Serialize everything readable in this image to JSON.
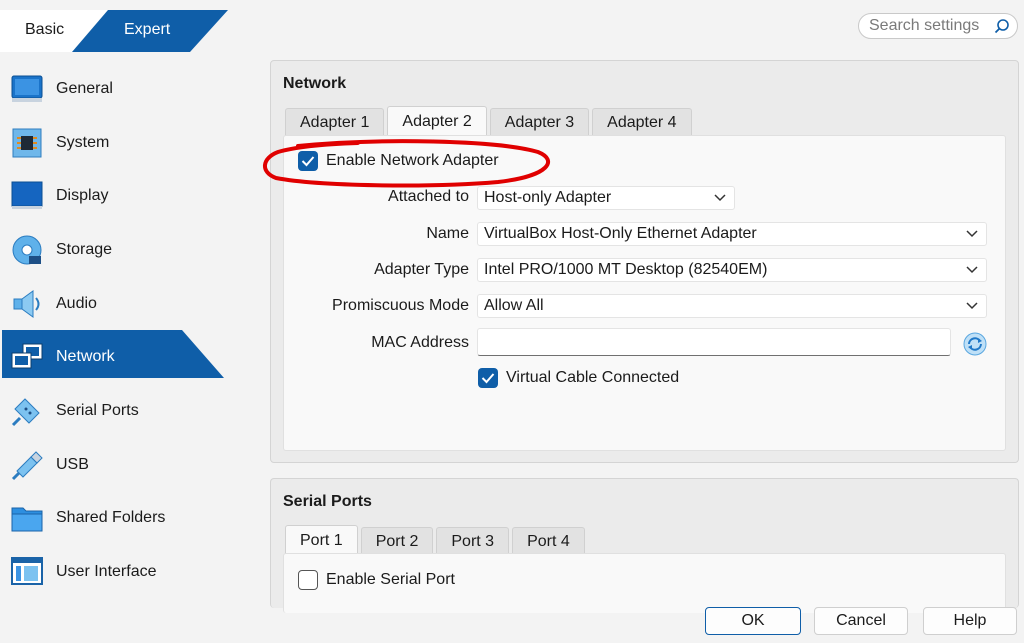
{
  "mode": {
    "basic_label": "Basic",
    "expert_label": "Expert",
    "selected": "Expert"
  },
  "search": {
    "placeholder": "Search settings"
  },
  "sidebar": {
    "items": [
      {
        "label": "General",
        "icon": "general-icon"
      },
      {
        "label": "System",
        "icon": "system-chip-icon"
      },
      {
        "label": "Display",
        "icon": "display-monitor-icon"
      },
      {
        "label": "Storage",
        "icon": "storage-disk-icon"
      },
      {
        "label": "Audio",
        "icon": "audio-speaker-icon"
      },
      {
        "label": "Network",
        "icon": "network-icon",
        "active": true
      },
      {
        "label": "Serial Ports",
        "icon": "serial-port-icon"
      },
      {
        "label": "USB",
        "icon": "usb-icon"
      },
      {
        "label": "Shared Folders",
        "icon": "shared-folder-icon"
      },
      {
        "label": "User Interface",
        "icon": "user-interface-icon"
      }
    ]
  },
  "network": {
    "title": "Network",
    "tabs": [
      "Adapter 1",
      "Adapter 2",
      "Adapter 3",
      "Adapter 4"
    ],
    "active_tab": "Adapter 2",
    "enable_label": "Enable Network Adapter",
    "enable_checked": true,
    "attached_to": {
      "label": "Attached to",
      "value": "Host-only Adapter"
    },
    "name": {
      "label": "Name",
      "value": "VirtualBox Host-Only Ethernet Adapter"
    },
    "adapter_type": {
      "label": "Adapter Type",
      "value": "Intel PRO/1000 MT Desktop (82540EM)"
    },
    "promiscuous_mode": {
      "label": "Promiscuous Mode",
      "value": "Allow All"
    },
    "mac_address": {
      "label": "MAC Address",
      "value": ""
    },
    "cable_label": "Virtual Cable Connected",
    "cable_checked": true
  },
  "serial": {
    "title": "Serial Ports",
    "tabs": [
      "Port 1",
      "Port 2",
      "Port 3",
      "Port 4"
    ],
    "active_tab": "Port 1",
    "enable_label": "Enable Serial Port",
    "enable_checked": false
  },
  "buttons": {
    "ok": "OK",
    "cancel": "Cancel",
    "help": "Help"
  },
  "colors": {
    "accent": "#0f5ea8",
    "annotation": "#e00000",
    "window_bg": "#f3f3f3"
  }
}
